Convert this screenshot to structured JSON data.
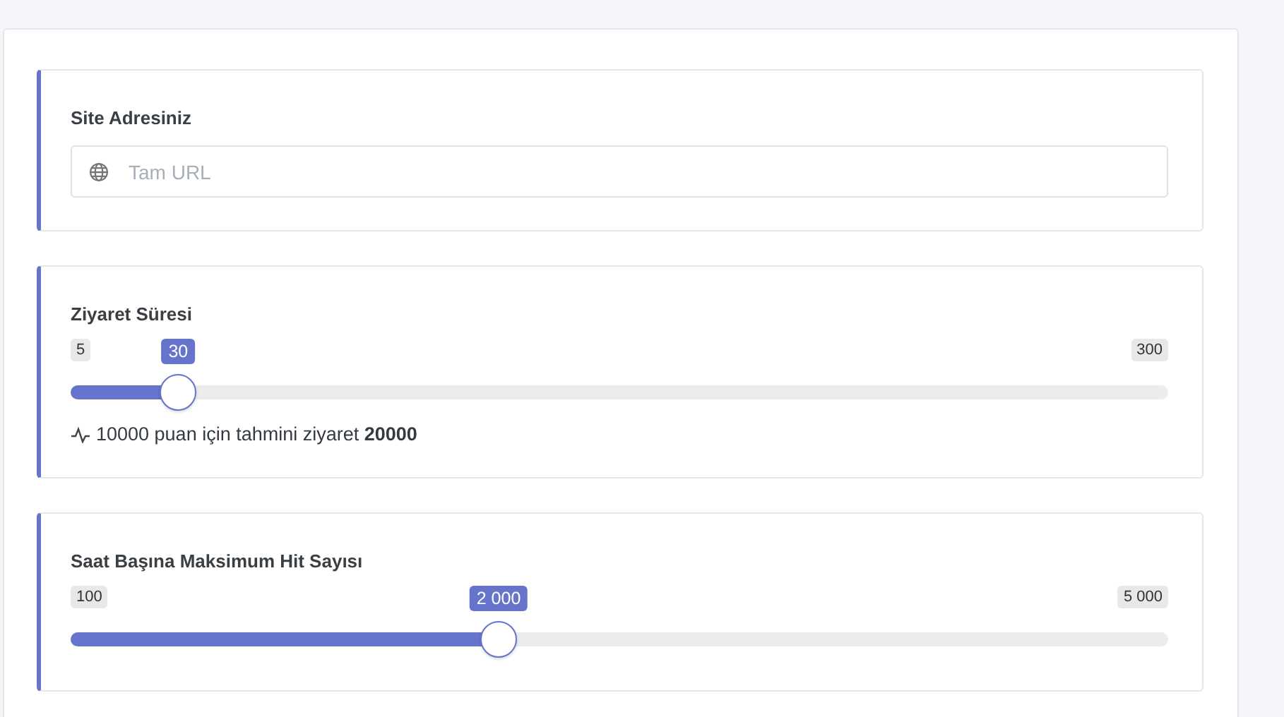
{
  "fields": [
    {
      "kind": "url",
      "label": "Site Adresiniz",
      "placeholder": "Tam URL"
    },
    {
      "kind": "range",
      "label": "Ziyaret Süresi",
      "min": "5",
      "max": "300",
      "value": "30",
      "level": 0.098,
      "note": "10000 puan için tahmini ziyaret **20000**"
    },
    {
      "kind": "range",
      "label": "Saat Başına Maksimum Hit Sayısı",
      "min": "100",
      "max": "5 000",
      "value": "2 000",
      "level": 0.39
    }
  ]
}
